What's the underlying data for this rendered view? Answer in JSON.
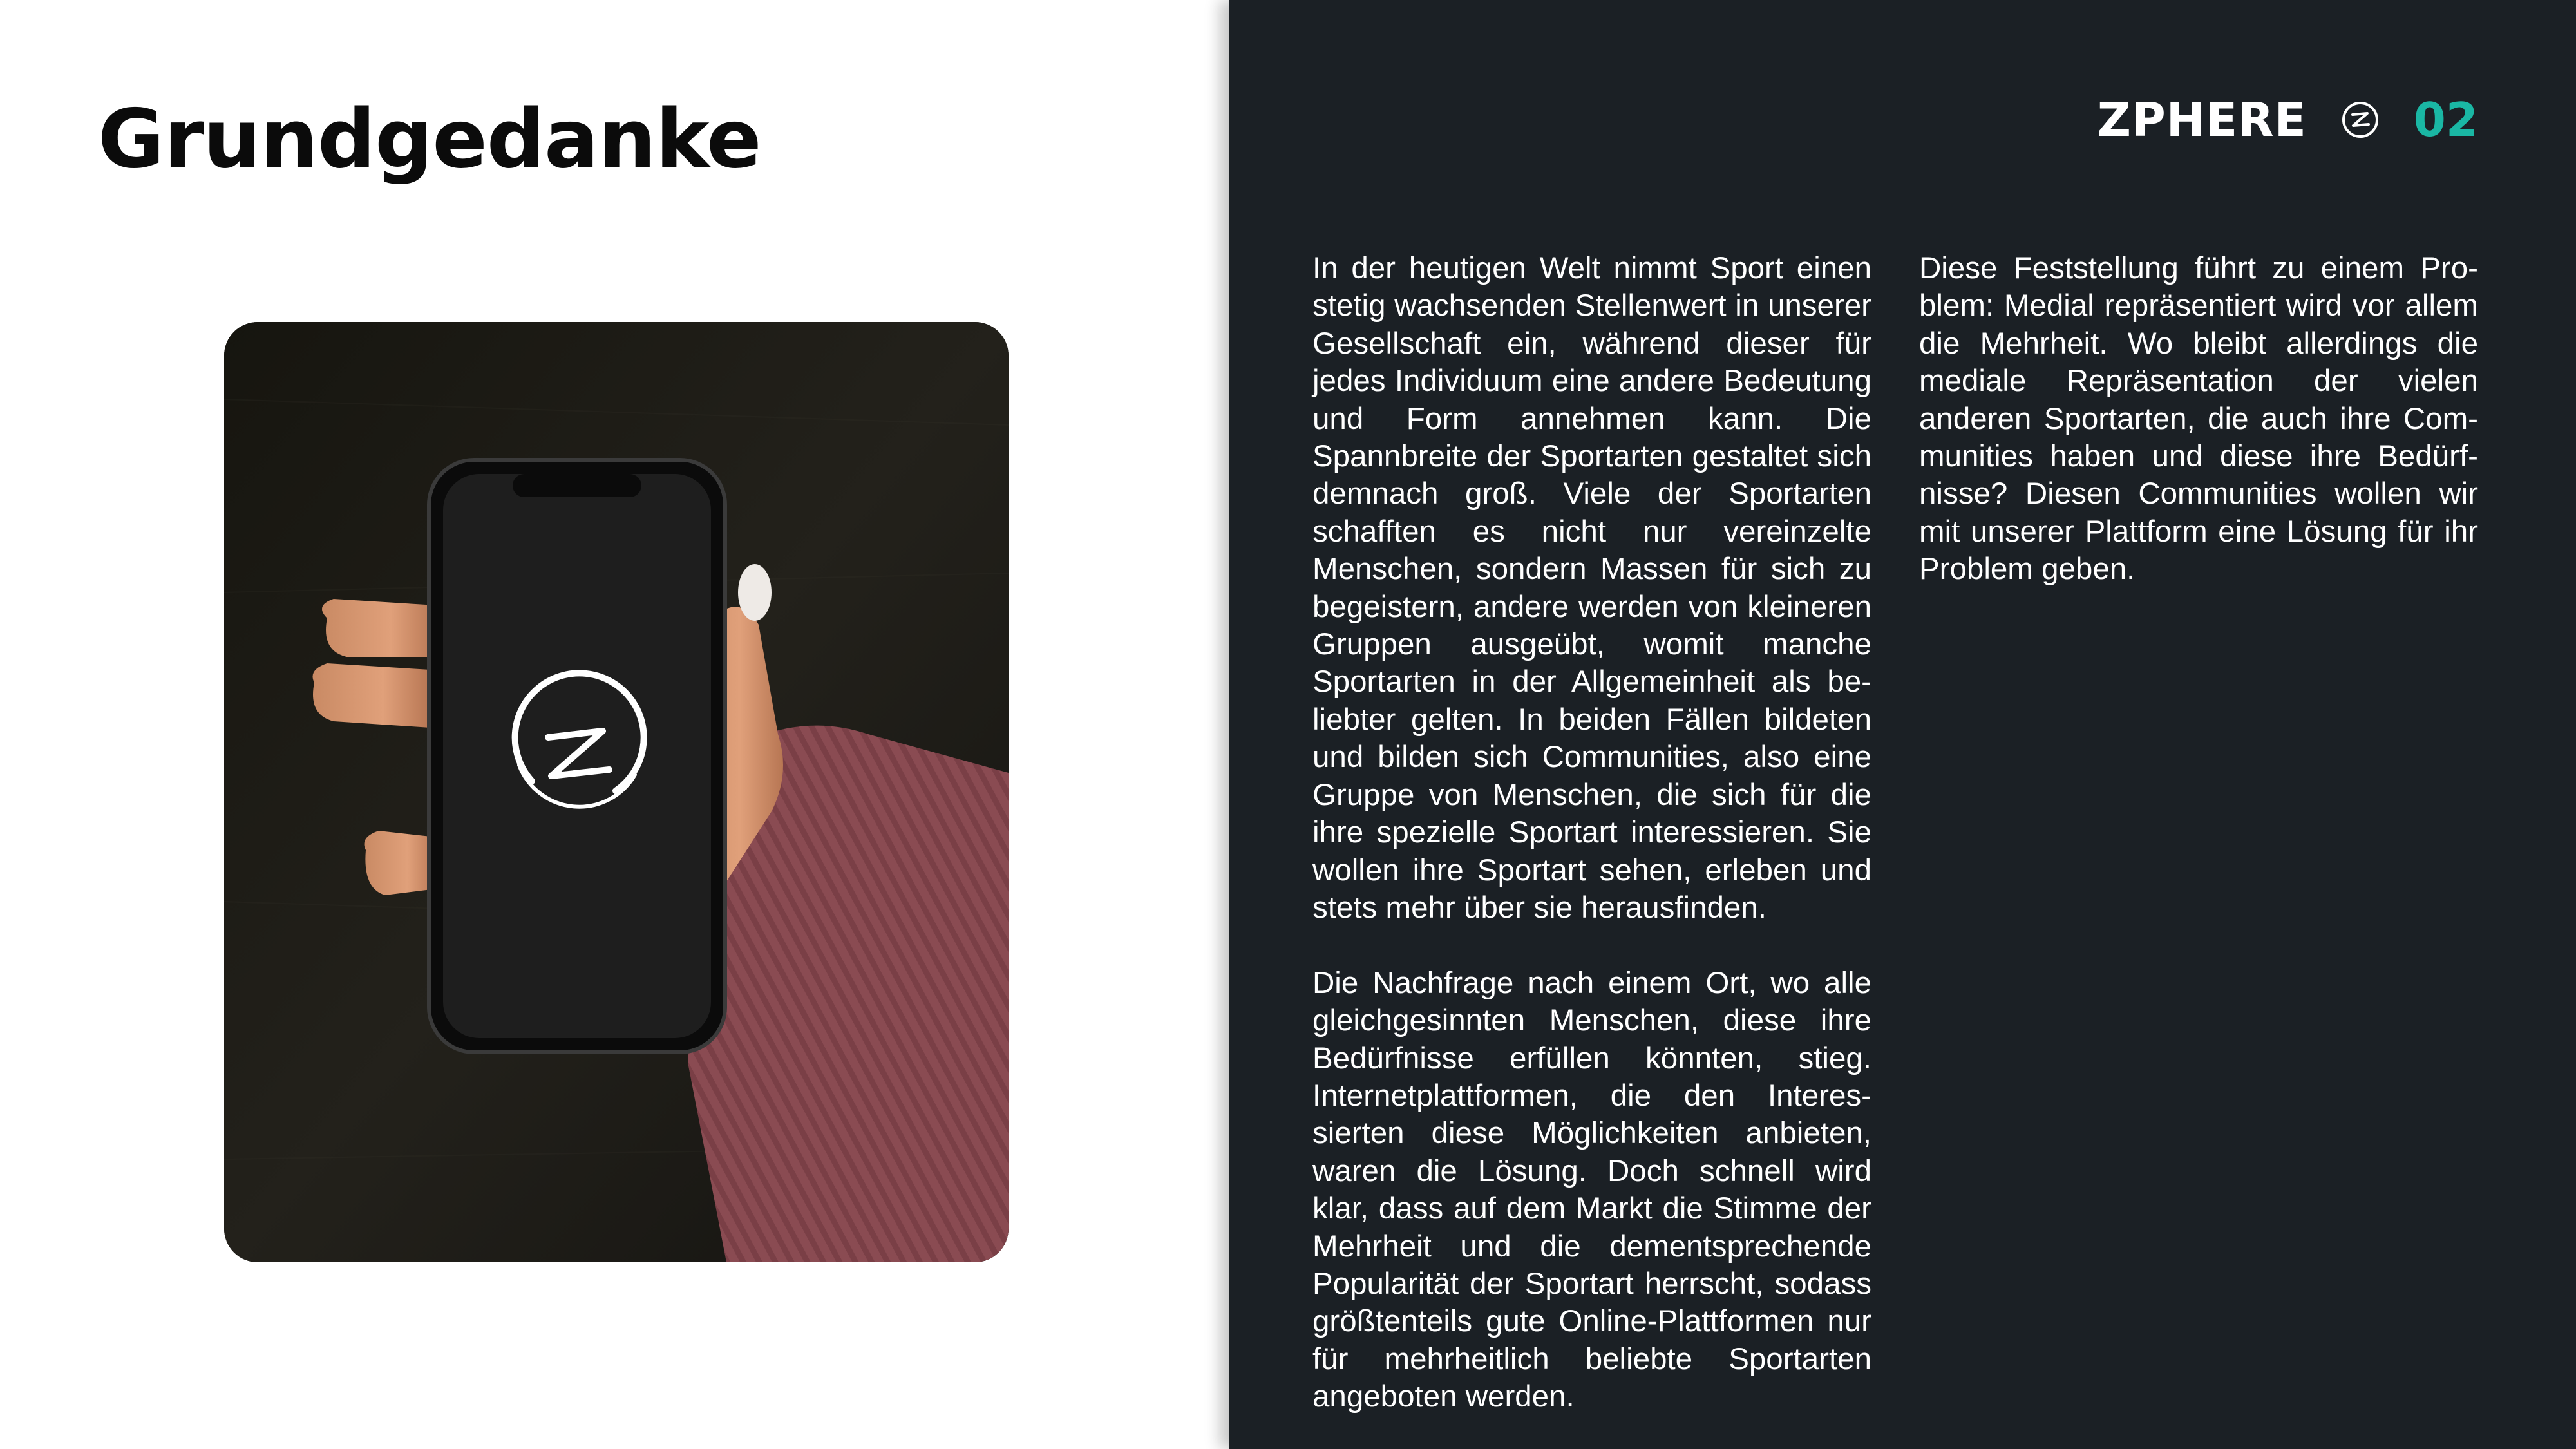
{
  "slide": {
    "title": "Grundgedanke",
    "brand_name": "ZPHERE",
    "brand_logo_icon": "zphere-logo-icon",
    "page_number": "02",
    "accent_color": "#1ab7a4",
    "panel_color": "#1b2025"
  },
  "image": {
    "description_icon": "hand-holding-phone-icon",
    "phone_logo_icon": "zphere-logo-icon"
  },
  "body": {
    "p1": "In der heutigen Welt nimmt Sport ei­nen stetig wachsenden Stellenwert in unserer Gesellschaft ein, während die­ser für jedes Individuum eine andere Bedeutung und Form annehmen kann. Die Spannbreite der Sportarten gestal­tet sich demnach groß. Viele der Sport­arten schafften es nicht nur vereinzelte Menschen, sondern Massen für sich zu begeistern, andere werden von kleine­ren Gruppen ausgeübt, womit manche Sportarten in der Allgemeinheit als be­liebter gelten. In beiden Fällen bildeten und bilden sich Communities, also eine Gruppe von Menschen, die sich für die ihre spezielle Sportart interessieren. Sie wollen ihre Sportart sehen, erleben und stets mehr über sie herausfinden.",
    "p2": "Die Nachfrage nach einem Ort, wo alle gleichgesinnten Menschen, diese ihre Bedürfnisse erfüllen könnten, stieg. Internetplattformen, die den Interes­sierten diese Möglichkeiten anbieten, waren die Lösung. Doch schnell wird klar, dass auf dem Markt die Stimme der Mehrheit und die dementsprechen­de Popularität der Sportart herrscht, sodass größtenteils gute Online-Platt­formen nur für mehrheitlich beliebte Sportarten angeboten werden.",
    "p3": "Diese Feststellung führt zu einem Pro­blem: Medial repräsentiert wird vor al­lem die Mehrheit. Wo bleibt allerdings die mediale Repräsentation der vielen anderen Sportarten, die auch ihre Com­munities haben und diese ihre Bedürf­nisse? Diesen Communities wollen wir mit unserer Plattform eine Lösung für ihr Problem geben."
  }
}
